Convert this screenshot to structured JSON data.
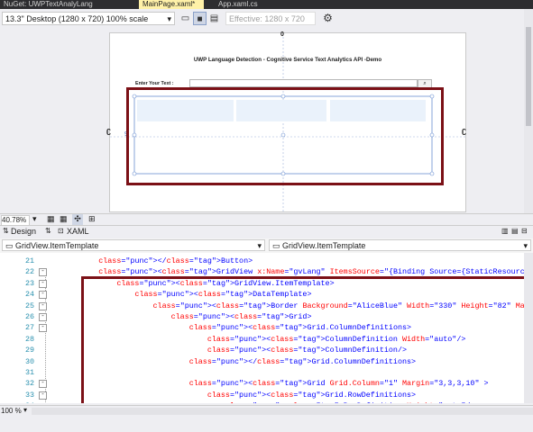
{
  "doc_tabs": [
    {
      "label": "NuGet: UWPTextAnalyLang",
      "active": false
    },
    {
      "label": "MainPage.xaml*",
      "active": true
    },
    {
      "label": "App.xaml.cs",
      "active": false
    }
  ],
  "toolbar": {
    "device_select": "13.3\" Desktop (1280 x 720) 100% scale",
    "effective_label": "Effective: 1280 x 720"
  },
  "designer": {
    "page_title": "UWP Language Detection - Cognitive Service Text Analytics API -Demo",
    "enter_text_label": "Enter Your Text :",
    "top_marker": "0",
    "side_marker": "9"
  },
  "zoom": {
    "value": "40.78%"
  },
  "view_tabs": {
    "design": "Design",
    "xaml": "XAML"
  },
  "breadcrumbs": {
    "left": "GridView.ItemTemplate",
    "right": "GridView.ItemTemplate"
  },
  "code_lines": [
    {
      "n": "21",
      "text": "        </Button>"
    },
    {
      "n": "22",
      "text": "        <GridView x:Name=\"gvLang\" ItemsSource=\"{Binding Source={StaticResource LanguageResultsCol}}\""
    },
    {
      "n": "23",
      "text": "            <GridView.ItemTemplate>"
    },
    {
      "n": "24",
      "text": "                <DataTemplate>"
    },
    {
      "n": "25",
      "text": "                    <Border Background=\"AliceBlue\" Width=\"330\" Height=\"82\" Margin=\"8\" >"
    },
    {
      "n": "26",
      "text": "                        <Grid>"
    },
    {
      "n": "27",
      "text": "                            <Grid.ColumnDefinitions>"
    },
    {
      "n": "28",
      "text": "                                <ColumnDefinition Width=\"auto\"/>"
    },
    {
      "n": "29",
      "text": "                                <ColumnDefinition/>"
    },
    {
      "n": "30",
      "text": "                            </Grid.ColumnDefinitions>"
    },
    {
      "n": "31",
      "text": ""
    },
    {
      "n": "32",
      "text": "                            <Grid Grid.Column=\"1\" Margin=\"3,3,3,10\" >"
    },
    {
      "n": "33",
      "text": "                                <Grid.RowDefinitions>"
    },
    {
      "n": "34",
      "text": "                                    <RowDefinition Height=\"auto\"/>"
    }
  ],
  "status": {
    "zoom": "100 %"
  },
  "colors": {
    "highlight_box": "#7b1016",
    "active_tab": "#fff1a8"
  }
}
